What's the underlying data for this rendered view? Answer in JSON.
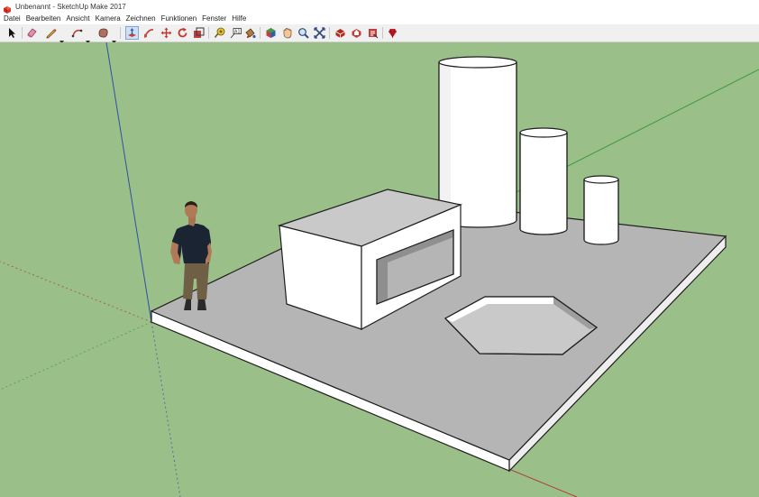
{
  "window": {
    "title": "Unbenannt - SketchUp Make 2017",
    "app_icon": "sketchup-logo-icon"
  },
  "menubar": {
    "items": [
      "Datei",
      "Bearbeiten",
      "Ansicht",
      "Kamera",
      "Zeichnen",
      "Funktionen",
      "Fenster",
      "Hilfe"
    ]
  },
  "toolbar": {
    "tools": [
      "select-arrow-icon",
      "eraser-icon",
      "line-pencil-icon",
      "arc-icon",
      "shape-icon",
      "push-pull-icon",
      "follow-me-icon",
      "move-icon",
      "rotate-icon",
      "scale-icon",
      "tape-measure-icon",
      "text-label-icon",
      "paint-bucket-icon",
      "orbit-icon",
      "pan-icon",
      "zoom-icon",
      "zoom-extents-icon",
      "3d-warehouse-icon",
      "extension-warehouse-icon",
      "send-to-layout-icon",
      "ruby-gem-icon"
    ],
    "active_tool": "push-pull-icon"
  },
  "colors": {
    "viewport_background": "#9bbf88",
    "face_front": "#ffffff",
    "face_back": "#b5b5b5",
    "edge": "#1e1e1e",
    "axis_red": "#b03a2e",
    "axis_green": "#3d9a3a",
    "axis_blue": "#2f4fa8"
  }
}
